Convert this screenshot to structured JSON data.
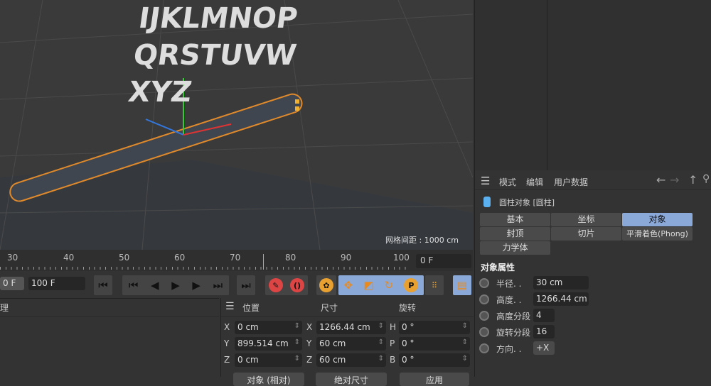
{
  "viewport": {
    "letters": [
      "IJKLMNOP",
      "QRSTUVW",
      "XYZ"
    ],
    "grid_spacing": "网格间距 : 1000 cm"
  },
  "timeline": {
    "ticks": [
      "30",
      "40",
      "50",
      "60",
      "70",
      "80",
      "90",
      "100"
    ],
    "current_frame": "0 F",
    "start_frame": "0 F",
    "end_frame": "100 F"
  },
  "left_panel": {
    "title": "理"
  },
  "coords": {
    "headers": [
      "位置",
      "尺寸",
      "旋转"
    ],
    "rows": [
      {
        "pos_axis": "X",
        "pos": "0 cm",
        "size_axis": "X",
        "size": "1266.44 cm",
        "rot_axis": "H",
        "rot": "0 °"
      },
      {
        "pos_axis": "Y",
        "pos": "899.514 cm",
        "size_axis": "Y",
        "size": "60 cm",
        "rot_axis": "P",
        "rot": "0 °"
      },
      {
        "pos_axis": "Z",
        "pos": "0 cm",
        "size_axis": "Z",
        "size": "60 cm",
        "rot_axis": "B",
        "rot": "0 °"
      }
    ],
    "buttons": [
      "对象 (相对)",
      "绝对尺寸",
      "应用"
    ]
  },
  "attributes": {
    "menu": [
      "模式",
      "编辑",
      "用户数据"
    ],
    "object_title": "圆柱对象 [圆柱]",
    "tabs": [
      "基本",
      "坐标",
      "对象",
      "封顶",
      "切片",
      "平滑着色(Phong)",
      "力学体"
    ],
    "active_tab": "对象",
    "section": "对象属性",
    "props": [
      {
        "label": "半径. .",
        "value": "30 cm"
      },
      {
        "label": "高度. .",
        "value": "1266.44 cm"
      },
      {
        "label": "高度分段",
        "value": "4"
      },
      {
        "label": "旋转分段",
        "value": "16"
      },
      {
        "label": "方向. .",
        "value": "+X"
      }
    ]
  },
  "colors": {
    "accent": "#8aa9d9",
    "selection": "#e08a2c"
  }
}
